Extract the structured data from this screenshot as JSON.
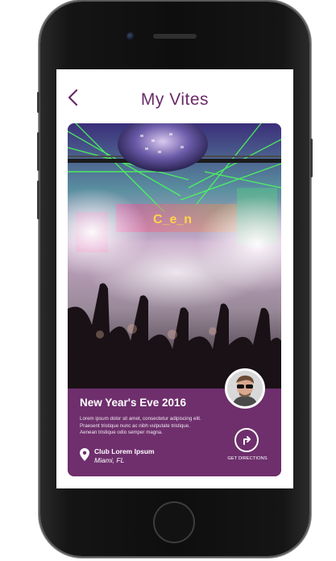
{
  "header": {
    "title": "My Vites"
  },
  "event": {
    "title": "New Year's Eve 2016",
    "description": "Lorem ipsum dolor sit amet, consectetur adipiscing elit. Praesent tristique nunc ac nibh vulputate tristique. Aenean tristique odio semper magna.",
    "venue": "Club Lorem Ipsum",
    "city": "Miami, FL",
    "directions_label": "GET DIRECTIONS",
    "photo_sign_text": "C_e_n"
  },
  "colors": {
    "accent": "#6e2f6c",
    "title": "#6b2a68"
  },
  "icons": {
    "back": "chevron-left-icon",
    "location": "location-pin-icon",
    "directions": "directions-arrow-icon"
  }
}
